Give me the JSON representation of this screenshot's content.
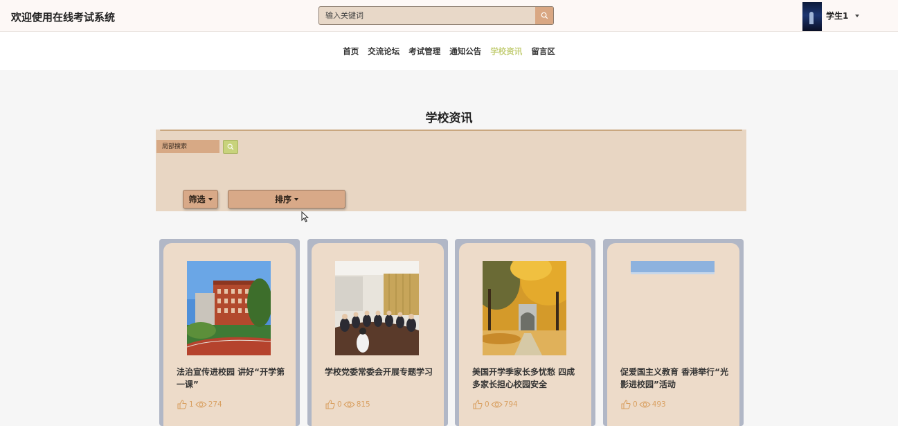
{
  "header": {
    "site_title": "欢迎使用在线考试系统",
    "search_placeholder": "输入关键词",
    "username": "学生1"
  },
  "nav": {
    "items": [
      {
        "label": "首页"
      },
      {
        "label": "交流论坛"
      },
      {
        "label": "考试管理"
      },
      {
        "label": "通知公告"
      },
      {
        "label": "学校资讯",
        "active": true
      },
      {
        "label": "留言区"
      }
    ]
  },
  "section": {
    "title": "学校资讯",
    "local_search_placeholder": "局部搜索",
    "filter_label": "筛选",
    "sort_label": "排序"
  },
  "cards": [
    {
      "title": "法治宣传进校园 讲好“开学第一课”",
      "likes": "1",
      "views": "274"
    },
    {
      "title": "学校党委常委会开展专题学习",
      "likes": "0",
      "views": "815"
    },
    {
      "title": "美国开学季家长多忧愁 四成多家长担心校园安全",
      "likes": "0",
      "views": "794"
    },
    {
      "title": "促爱国主义教育 香港举行“光影进校园”活动",
      "likes": "0",
      "views": "493"
    }
  ],
  "colors": {
    "accent_active_nav": "#c5cf7a",
    "stat_color": "#d9a061",
    "panel_bg": "#e8d6c3",
    "card_frame": "#b1b7c6"
  }
}
